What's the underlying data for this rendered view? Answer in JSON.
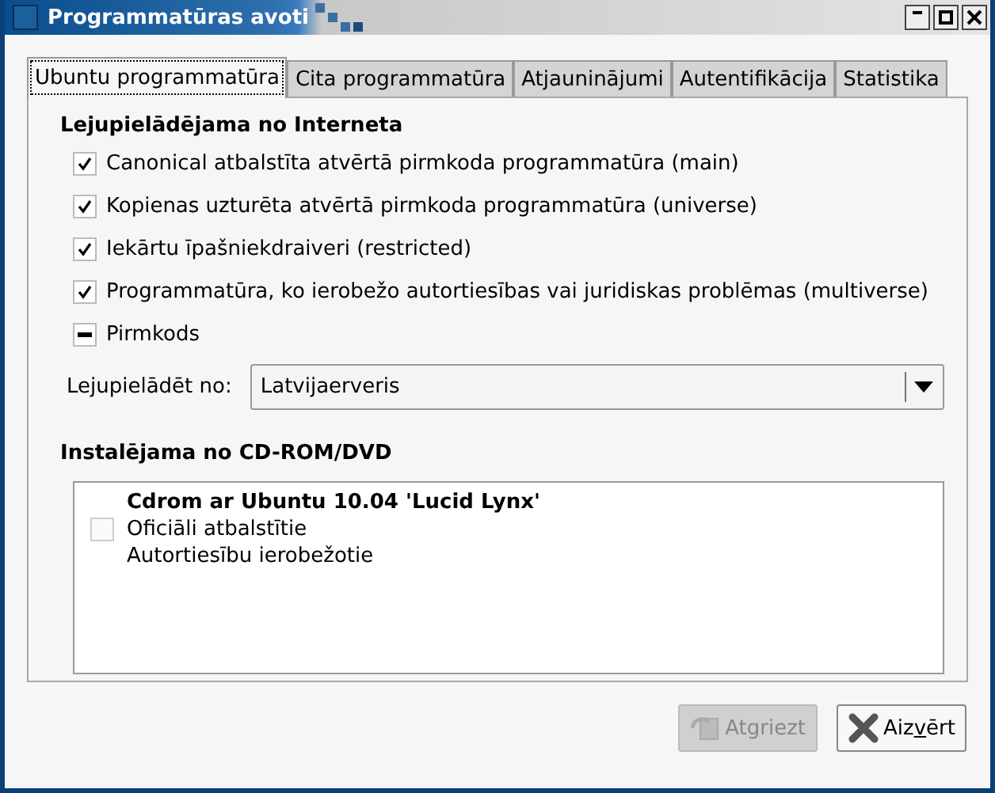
{
  "window": {
    "title": "Programmatūras avoti"
  },
  "tabs": [
    {
      "label": "Ubuntu programmatūra",
      "selected": true
    },
    {
      "label": "Cita programmatūra",
      "selected": false
    },
    {
      "label": "Atjauninājumi",
      "selected": false
    },
    {
      "label": "Autentifikācija",
      "selected": false
    },
    {
      "label": "Statistika",
      "selected": false
    }
  ],
  "internet": {
    "heading": "Lejupielādējama no Interneta",
    "options": [
      {
        "label": "Canonical atbalstīta atvērtā pirmkoda programmatūra (main)",
        "checked": true
      },
      {
        "label": "Kopienas uzturēta atvērtā pirmkoda programmatūra (universe)",
        "checked": true
      },
      {
        "label": "Iekārtu īpašniekdraiveri (restricted)",
        "checked": true
      },
      {
        "label": "Programmatūra, ko ierobežo autortiesības vai juridiskas problēmas (multiverse)",
        "checked": true
      },
      {
        "label": "Pirmkods",
        "inconsistent": true
      }
    ],
    "download_from": {
      "label": "Lejupielādēt no:",
      "value": "Latvijaerveris"
    }
  },
  "cdrom": {
    "heading": "Instalējama no CD-ROM/DVD",
    "items": [
      {
        "checked": false,
        "title": "Cdrom ar Ubuntu 10.04 'Lucid Lynx'",
        "lines": [
          "Oficiāli atbalstītie",
          "Autortiesību ierobežotie"
        ]
      }
    ]
  },
  "buttons": [
    {
      "kind": "revert",
      "label_parts": [
        "At",
        "g",
        "riezt"
      ],
      "disabled": true
    },
    {
      "kind": "close",
      "label_parts": [
        "Aiz",
        "v",
        "ērt"
      ],
      "disabled": false
    }
  ]
}
